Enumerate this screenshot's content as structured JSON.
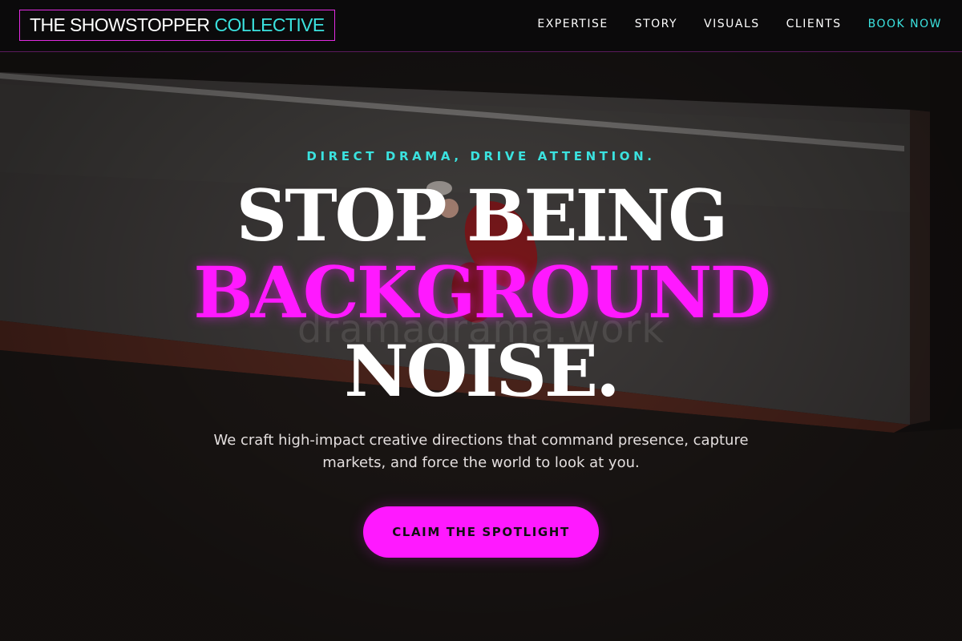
{
  "nav": {
    "brand_primary": "THE SHOWSTOPPER",
    "brand_accent": "COLLECTIVE",
    "links": [
      {
        "label": "EXPERTISE"
      },
      {
        "label": "STORY"
      },
      {
        "label": "VISUALS"
      },
      {
        "label": "CLIENTS"
      },
      {
        "label": "BOOK NOW"
      }
    ]
  },
  "hero": {
    "eyebrow": "DIRECT DRAMA, DRIVE ATTENTION.",
    "headline_line1": "STOP BEING",
    "headline_line2": "BACKGROUND",
    "headline_line3": "NOISE.",
    "watermark": "dramadrama.work",
    "subcopy": "We craft high-impact creative directions that command presence, capture markets, and force the world to look at you.",
    "cta_label": "CLAIM THE SPOTLIGHT"
  },
  "colors": {
    "accent_cyan": "#3be2df",
    "accent_magenta": "#ff19ff",
    "background": "#0b0a0b"
  }
}
